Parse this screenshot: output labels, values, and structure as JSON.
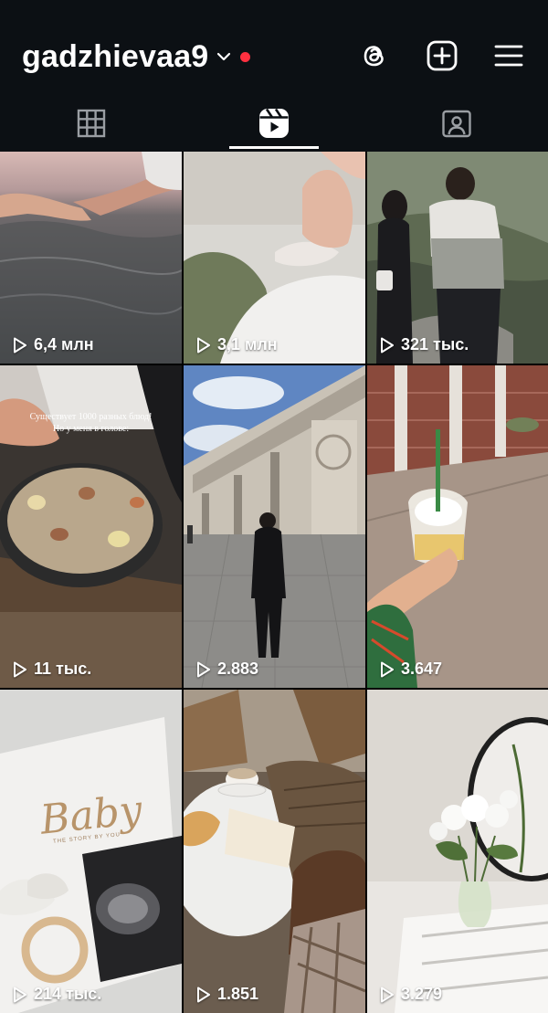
{
  "header": {
    "username": "gadzhievaa9",
    "icons": [
      "threads-icon",
      "create-plus-icon",
      "menu-icon"
    ],
    "notification_dot_color": "#ff3040"
  },
  "tabs": {
    "items": [
      "grid-tab",
      "reels-tab",
      "tagged-tab"
    ],
    "active": "reels-tab"
  },
  "reels": [
    {
      "views": "6,4 млн"
    },
    {
      "views": "3,1 млн"
    },
    {
      "views": "321 тыс."
    },
    {
      "views": "11 тыс.",
      "caption_line1": "Существует 1000 разных блюд!",
      "caption_line2": "Но у меня в голове:"
    },
    {
      "views": "2.883"
    },
    {
      "views": "3.647"
    },
    {
      "views": "214 тыс.",
      "book_title": "Baby",
      "book_subtitle": "THE STORY BY YOU"
    },
    {
      "views": "1.851"
    },
    {
      "views": "3.279"
    }
  ]
}
